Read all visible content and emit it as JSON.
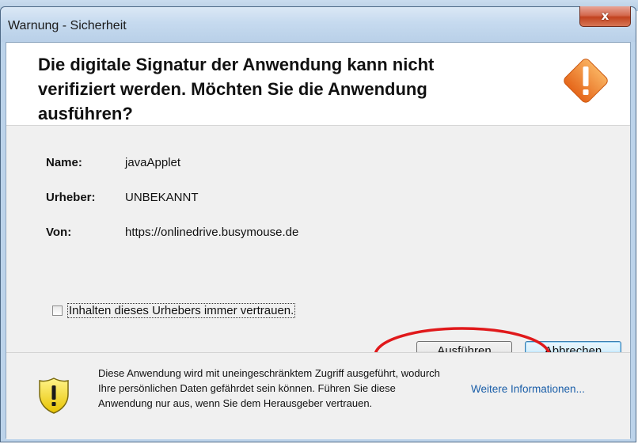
{
  "background": {
    "partial_text": ""
  },
  "dialog": {
    "title": "Warnung - Sicherheit",
    "close_label": "x",
    "heading": "Die digitale Signatur der Anwendung kann nicht verifiziert werden.  Möchten Sie die Anwendung ausführen?",
    "header_icon": "warning-diamond-icon",
    "fields": [
      {
        "label": "Name:",
        "value": "javaApplet"
      },
      {
        "label": "Urheber:",
        "value": "UNBEKANNT"
      },
      {
        "label": "Von:",
        "value": "https://onlinedrive.busymouse.de"
      }
    ],
    "checkbox": {
      "label": "Inhalten dieses Urhebers immer vertrauen.",
      "checked": false
    },
    "buttons": {
      "run": "Ausführen",
      "cancel": "Abbrechen"
    },
    "footer": {
      "icon": "shield-warning-icon",
      "text": "Diese Anwendung wird mit uneingeschränktem Zugriff ausgeführt, wodurch Ihre persönlichen Daten gefährdet sein können. Führen Sie diese Anwendung nur aus, wenn Sie dem Herausgeber vertrauen.",
      "more_info": "Weitere Informationen..."
    },
    "annotation_color": "#e0191b"
  }
}
